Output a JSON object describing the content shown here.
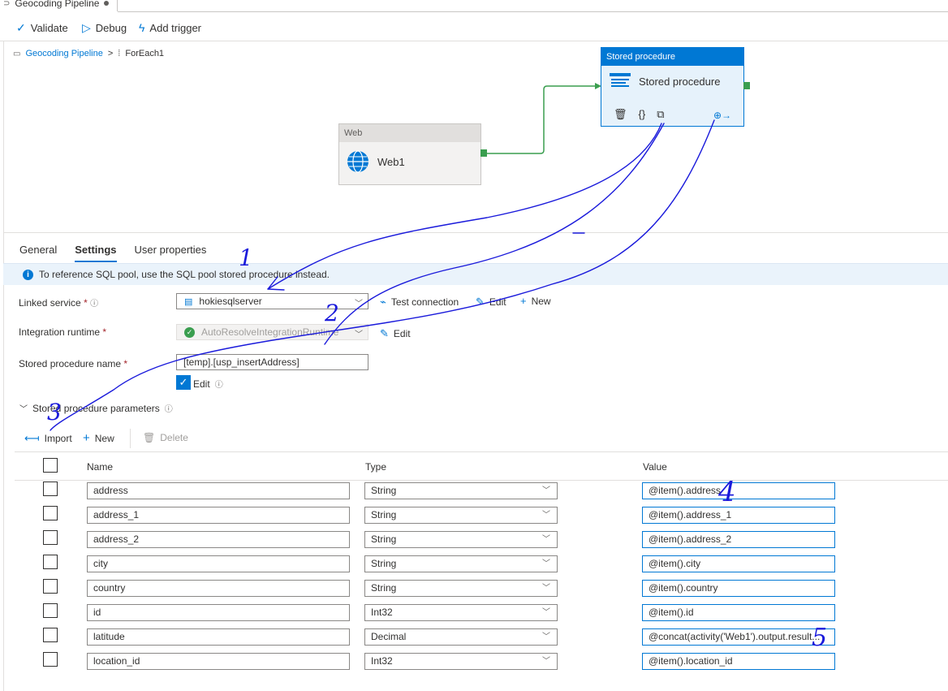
{
  "tab": {
    "title": "Geocoding Pipeline"
  },
  "toolbar": {
    "validate": "Validate",
    "debug": "Debug",
    "add_trigger": "Add trigger"
  },
  "breadcrumb": {
    "pipeline": "Geocoding Pipeline",
    "separator": ">",
    "current": "ForEach1"
  },
  "canvas": {
    "web_node": {
      "type": "Web",
      "name": "Web1"
    },
    "sp_node": {
      "type": "Stored procedure",
      "name": "Stored procedure"
    }
  },
  "panel_tabs": [
    "General",
    "Settings",
    "User properties"
  ],
  "active_tab": "Settings",
  "info": {
    "text": "To reference SQL pool, use the SQL pool stored procedure instead."
  },
  "form": {
    "linked_service_label": "Linked service",
    "linked_service_value": "hokiesqlserver",
    "test_connection": "Test connection",
    "edit": "Edit",
    "new": "New",
    "runtime_label": "Integration runtime",
    "runtime_value": "AutoResolveIntegrationRuntime",
    "sp_name_label": "Stored procedure name",
    "sp_name_value": "[temp].[usp_insertAddress]",
    "edit_checkbox": "Edit",
    "params_section": "Stored procedure parameters"
  },
  "param_actions": {
    "import": "Import",
    "new": "New",
    "delete": "Delete"
  },
  "table": {
    "headers": {
      "name": "Name",
      "type": "Type",
      "value": "Value"
    },
    "rows": [
      {
        "name": "address",
        "type": "String",
        "value": "@item().address"
      },
      {
        "name": "address_1",
        "type": "String",
        "value": "@item().address_1"
      },
      {
        "name": "address_2",
        "type": "String",
        "value": "@item().address_2"
      },
      {
        "name": "city",
        "type": "String",
        "value": "@item().city"
      },
      {
        "name": "country",
        "type": "String",
        "value": "@item().country"
      },
      {
        "name": "id",
        "type": "Int32",
        "value": "@item().id"
      },
      {
        "name": "latitude",
        "type": "Decimal",
        "value": "@concat(activity('Web1').output.result..."
      },
      {
        "name": "location_id",
        "type": "Int32",
        "value": "@item().location_id"
      }
    ]
  },
  "annotations": {
    "n1": "1",
    "n2": "2",
    "n3": "3",
    "n4": "4",
    "n5": "5"
  },
  "colors": {
    "accent": "#0078d4",
    "success": "#3a9e4f",
    "ink": "#1a1adb"
  }
}
